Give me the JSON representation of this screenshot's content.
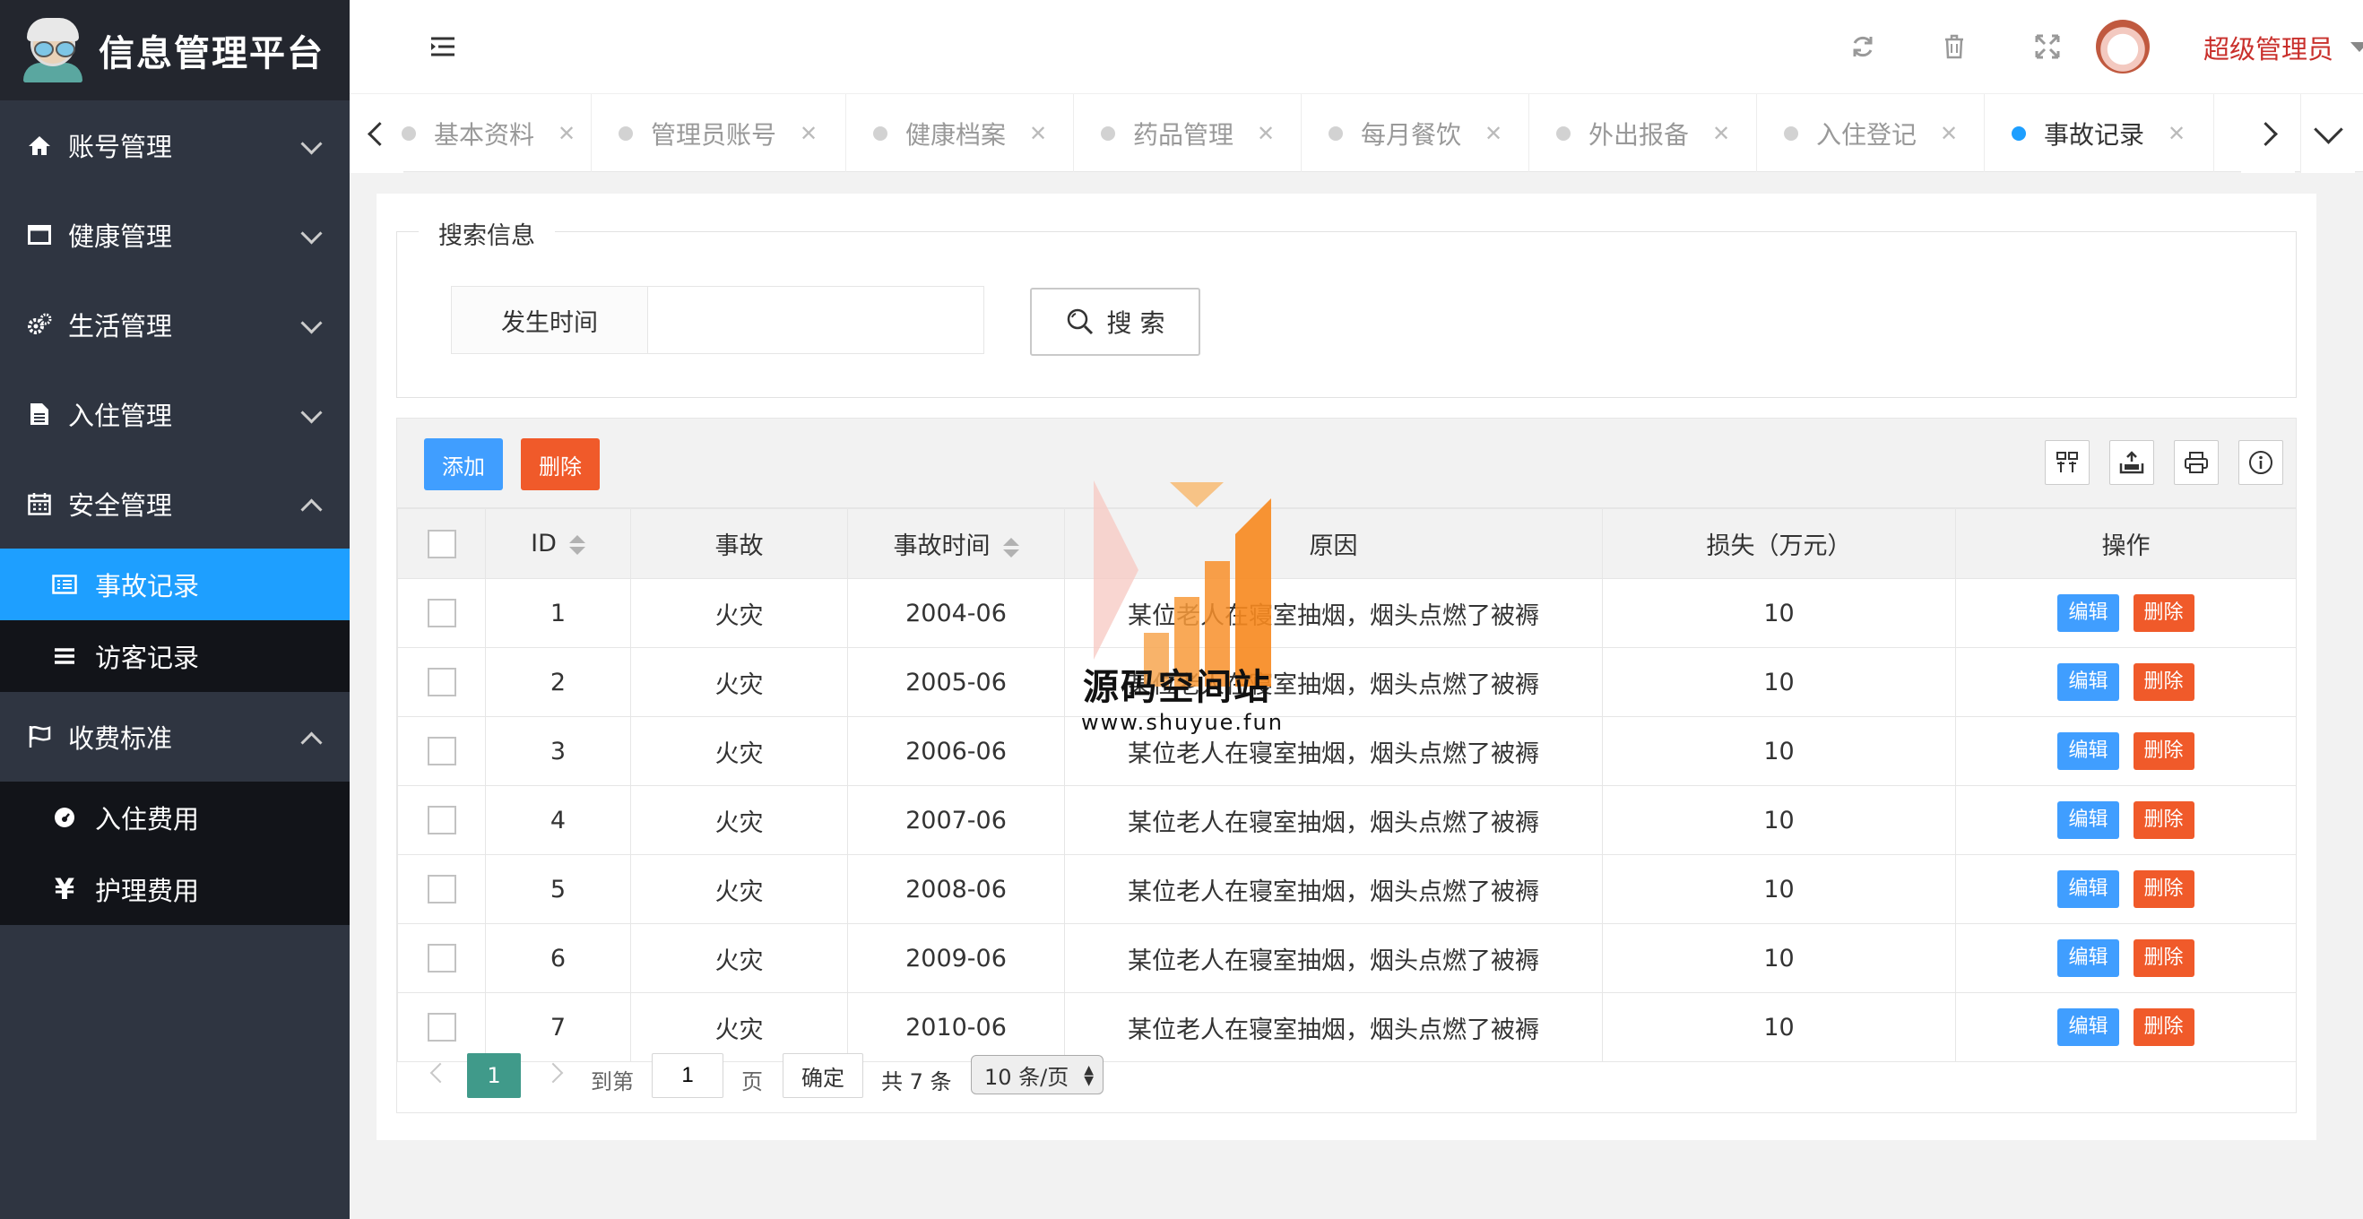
{
  "app": {
    "title": "信息管理平台"
  },
  "sidebar": {
    "menus": [
      {
        "label": "账号管理",
        "icon": "home-icon",
        "expanded": false
      },
      {
        "label": "健康管理",
        "icon": "window-icon",
        "expanded": false
      },
      {
        "label": "生活管理",
        "icon": "gears-icon",
        "expanded": false
      },
      {
        "label": "入住管理",
        "icon": "file-icon",
        "expanded": false
      },
      {
        "label": "安全管理",
        "icon": "calendar-icon",
        "expanded": true,
        "children": [
          {
            "label": "事故记录",
            "icon": "list-alt-icon",
            "active": true
          },
          {
            "label": "访客记录",
            "icon": "bars-icon"
          }
        ]
      },
      {
        "label": "收费标准",
        "icon": "flag-icon",
        "expanded": true,
        "children": [
          {
            "label": "入住费用",
            "icon": "dashboard-icon"
          },
          {
            "label": "护理费用",
            "icon": "yen-icon"
          }
        ]
      }
    ]
  },
  "header": {
    "icons": [
      "menu-toggle-icon",
      "refresh-icon",
      "trash-icon",
      "fullscreen-icon"
    ],
    "user_name": "超级管理员"
  },
  "tabs": [
    {
      "label": "基本资料",
      "active": false
    },
    {
      "label": "管理员账号",
      "active": false
    },
    {
      "label": "健康档案",
      "active": false
    },
    {
      "label": "药品管理",
      "active": false
    },
    {
      "label": "每月餐饮",
      "active": false
    },
    {
      "label": "外出报备",
      "active": false
    },
    {
      "label": "入住登记",
      "active": false
    },
    {
      "label": "事故记录",
      "active": true
    }
  ],
  "search": {
    "legend": "搜索信息",
    "field_label": "发生时间",
    "value": "",
    "button_label": "搜 索"
  },
  "toolbar": {
    "add_label": "添加",
    "delete_label": "删除"
  },
  "table": {
    "columns": [
      "ID",
      "事故",
      "事故时间",
      "原因",
      "损失（万元）",
      "操作"
    ],
    "edit_label": "编辑",
    "delete_label": "删除",
    "rows": [
      {
        "id": "1",
        "type": "火灾",
        "time": "2004-06",
        "reason": "某位老人在寝室抽烟，烟头点燃了被褥",
        "loss": "10"
      },
      {
        "id": "2",
        "type": "火灾",
        "time": "2005-06",
        "reason": "某位老人在寝室抽烟，烟头点燃了被褥",
        "loss": "10"
      },
      {
        "id": "3",
        "type": "火灾",
        "time": "2006-06",
        "reason": "某位老人在寝室抽烟，烟头点燃了被褥",
        "loss": "10"
      },
      {
        "id": "4",
        "type": "火灾",
        "time": "2007-06",
        "reason": "某位老人在寝室抽烟，烟头点燃了被褥",
        "loss": "10"
      },
      {
        "id": "5",
        "type": "火灾",
        "time": "2008-06",
        "reason": "某位老人在寝室抽烟，烟头点燃了被褥",
        "loss": "10"
      },
      {
        "id": "6",
        "type": "火灾",
        "time": "2009-06",
        "reason": "某位老人在寝室抽烟，烟头点燃了被褥",
        "loss": "10"
      },
      {
        "id": "7",
        "type": "火灾",
        "time": "2010-06",
        "reason": "某位老人在寝室抽烟，烟头点燃了被褥",
        "loss": "10"
      }
    ]
  },
  "pager": {
    "current_page": "1",
    "goto_label": "到第",
    "goto_value": "1",
    "page_unit": "页",
    "confirm_label": "确定",
    "total_label": "共 7 条",
    "page_size": "10 条/页"
  },
  "watermark": {
    "title": "源码空间站",
    "url": "www.shuyue.fun"
  },
  "colors": {
    "primary": "#1e9fff",
    "danger": "#f05a2a",
    "sidebar": "#2f3541",
    "user": "#c9302c"
  }
}
